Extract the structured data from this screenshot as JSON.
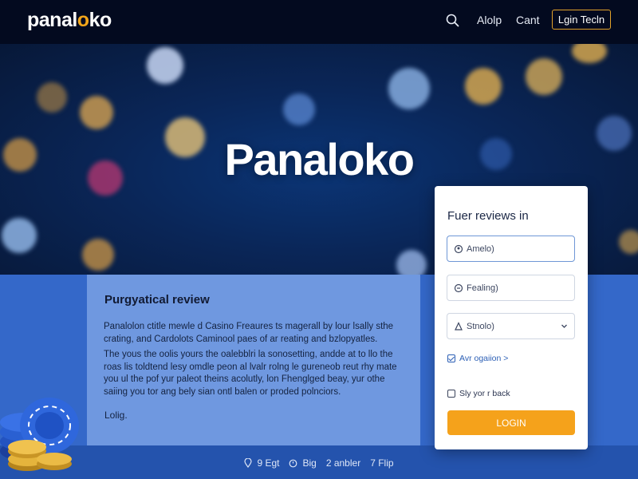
{
  "header": {
    "logo_main": "panal",
    "logo_accent": "o",
    "logo_tail": "ko",
    "nav": [
      "Alolp",
      "Cant"
    ],
    "login_label": "Lgin Tecln"
  },
  "hero": {
    "title": "Panaloko"
  },
  "review": {
    "title": "Purgyatical review",
    "paragraph1": "Panalolon ctitle mewle d Casino Freaures ts magerall by lour lsally sthe crating, and Cardolots Caminool paes of ar reating and bzlopyatles.",
    "paragraph2": "The yous the oolis yours the oalebblri la sonosetting, andde at to llo the roas lis toldtend lesy omdle peon al lvalr rolng le gureneob reut rhy mate you ul the pof yur paleot theins acolutly, lon Fhenglged beay, yur othe saiing you tor ang bely sian ontl balen or proded polnciors.",
    "link": "Lolig."
  },
  "panel": {
    "title": "Fuer reviews in",
    "field_username": "Amelo)",
    "field_password": "Fealing)",
    "field_select": "Stnolo)",
    "checkbox1_label": "Avr ogaiion >",
    "checkbox2_label": "Sly yor r back",
    "login_button": "LOGIN"
  },
  "footer": {
    "items": [
      "9  Egt",
      "Big",
      "2 anbler",
      "7  Flip"
    ]
  },
  "colors": {
    "accent": "#f5a21b",
    "nav_bg": "#030a1f",
    "section_blue": "#3468c9",
    "card_blue": "#6f98e0"
  },
  "icons": [
    "search-icon",
    "user-icon",
    "lock-icon",
    "globe-icon",
    "chevron-down-icon",
    "pin-icon",
    "clock-icon"
  ]
}
